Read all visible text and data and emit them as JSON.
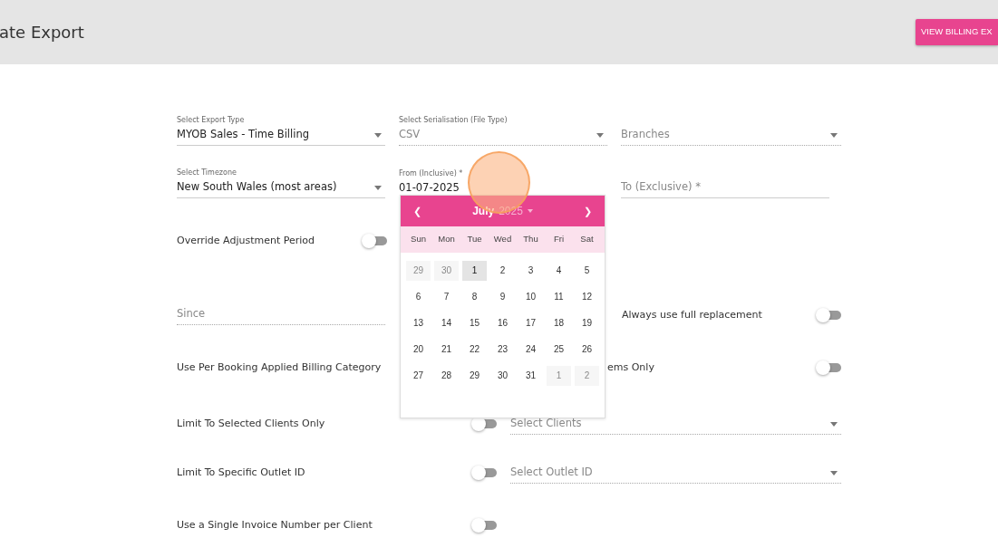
{
  "header": {
    "title": "ate Export",
    "button": "VIEW BILLING EX"
  },
  "export_type": {
    "label": "Select Export Type",
    "value": "MYOB Sales - Time Billing"
  },
  "serialisation": {
    "label": "Select Serialisation (File Type)",
    "value": "CSV",
    "disabled": true
  },
  "branches": {
    "placeholder": "Branches",
    "disabled": true
  },
  "timezone": {
    "label": "Select Timezone",
    "value": "New South Wales (most areas)"
  },
  "from": {
    "label": "From (Inclusive) *",
    "value": "01-07-2025"
  },
  "to": {
    "placeholder": "To (Exclusive) *"
  },
  "override": {
    "label": "Override Adjustment Period",
    "on": false
  },
  "since": {
    "placeholder": "Since",
    "disabled": true
  },
  "full_replacement": {
    "label": "Always use full replacement",
    "on": false
  },
  "billing_category": {
    "label": "Use Per Booking Applied Billing Category"
  },
  "items_only": {
    "label": "ems Only",
    "on": false
  },
  "clients": {
    "label": "Limit To Selected Clients Only",
    "on": false,
    "placeholder": "Select Clients",
    "disabled": true
  },
  "outlet": {
    "label": "Limit To Specific Outlet ID",
    "on": false,
    "placeholder": "Select Outlet ID",
    "disabled": true
  },
  "single_invoice": {
    "label": "Use a Single Invoice Number per Client",
    "on": false
  },
  "datepicker": {
    "prev": "❮",
    "next": "❯",
    "month": "July",
    "year": "2025",
    "weekdays": [
      "Sun",
      "Mon",
      "Tue",
      "Wed",
      "Thu",
      "Fri",
      "Sat"
    ],
    "weeks": [
      [
        {
          "day": "29",
          "outside": true,
          "selected": false
        },
        {
          "day": "30",
          "outside": true,
          "selected": false
        },
        {
          "day": "1",
          "outside": false,
          "selected": true
        },
        {
          "day": "2",
          "outside": false,
          "selected": false
        },
        {
          "day": "3",
          "outside": false,
          "selected": false
        },
        {
          "day": "4",
          "outside": false,
          "selected": false
        },
        {
          "day": "5",
          "outside": false,
          "selected": false
        }
      ],
      [
        {
          "day": "6",
          "outside": false,
          "selected": false
        },
        {
          "day": "7",
          "outside": false,
          "selected": false
        },
        {
          "day": "8",
          "outside": false,
          "selected": false
        },
        {
          "day": "9",
          "outside": false,
          "selected": false
        },
        {
          "day": "10",
          "outside": false,
          "selected": false
        },
        {
          "day": "11",
          "outside": false,
          "selected": false
        },
        {
          "day": "12",
          "outside": false,
          "selected": false
        }
      ],
      [
        {
          "day": "13",
          "outside": false,
          "selected": false
        },
        {
          "day": "14",
          "outside": false,
          "selected": false
        },
        {
          "day": "15",
          "outside": false,
          "selected": false
        },
        {
          "day": "16",
          "outside": false,
          "selected": false
        },
        {
          "day": "17",
          "outside": false,
          "selected": false
        },
        {
          "day": "18",
          "outside": false,
          "selected": false
        },
        {
          "day": "19",
          "outside": false,
          "selected": false
        }
      ],
      [
        {
          "day": "20",
          "outside": false,
          "selected": false
        },
        {
          "day": "21",
          "outside": false,
          "selected": false
        },
        {
          "day": "22",
          "outside": false,
          "selected": false
        },
        {
          "day": "23",
          "outside": false,
          "selected": false
        },
        {
          "day": "24",
          "outside": false,
          "selected": false
        },
        {
          "day": "25",
          "outside": false,
          "selected": false
        },
        {
          "day": "26",
          "outside": false,
          "selected": false
        }
      ],
      [
        {
          "day": "27",
          "outside": false,
          "selected": false
        },
        {
          "day": "28",
          "outside": false,
          "selected": false
        },
        {
          "day": "29",
          "outside": false,
          "selected": false
        },
        {
          "day": "30",
          "outside": false,
          "selected": false
        },
        {
          "day": "31",
          "outside": false,
          "selected": false
        },
        {
          "day": "1",
          "outside": true,
          "selected": false
        },
        {
          "day": "2",
          "outside": true,
          "selected": false
        }
      ]
    ]
  }
}
